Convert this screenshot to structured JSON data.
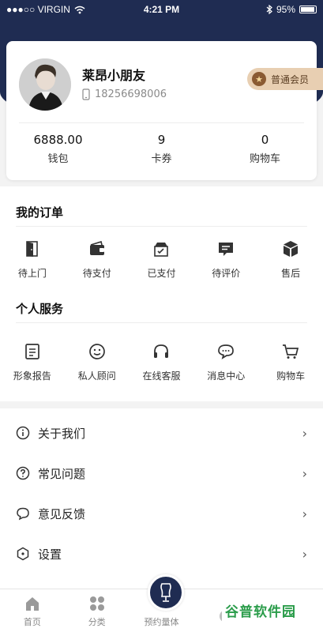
{
  "status_bar": {
    "carrier": "●●●○○ VIRGIN",
    "time": "4:21 PM",
    "battery": "95%"
  },
  "profile": {
    "name": "莱昂小朋友",
    "phone": "18256698006",
    "member_badge": "普通会员",
    "stats": [
      {
        "value": "6888.00",
        "label": "钱包"
      },
      {
        "value": "9",
        "label": "卡券"
      },
      {
        "value": "0",
        "label": "购物车"
      }
    ]
  },
  "orders": {
    "title": "我的订单",
    "items": [
      {
        "label": "待上门",
        "icon": "door-icon"
      },
      {
        "label": "待支付",
        "icon": "wallet-icon"
      },
      {
        "label": "已支付",
        "icon": "paid-box-icon"
      },
      {
        "label": "待评价",
        "icon": "comment-icon"
      },
      {
        "label": "售后",
        "icon": "package-icon"
      }
    ]
  },
  "services": {
    "title": "个人服务",
    "items": [
      {
        "label": "形象报告",
        "icon": "report-icon"
      },
      {
        "label": "私人顾问",
        "icon": "smiley-icon"
      },
      {
        "label": "在线客服",
        "icon": "headset-icon"
      },
      {
        "label": "消息中心",
        "icon": "chat-bubble-icon"
      },
      {
        "label": "购物车",
        "icon": "cart-icon"
      }
    ]
  },
  "menu": [
    {
      "label": "关于我们",
      "icon": "info-icon"
    },
    {
      "label": "常见问题",
      "icon": "question-icon"
    },
    {
      "label": "意见反馈",
      "icon": "feedback-icon"
    },
    {
      "label": "设置",
      "icon": "settings-icon"
    }
  ],
  "tab_bar": {
    "tabs": [
      {
        "label": "首页",
        "icon": "home-icon"
      },
      {
        "label": "分类",
        "icon": "grid-icon"
      },
      {
        "label": "预约量体",
        "icon": "mannequin-icon"
      },
      {
        "label": "",
        "icon": "circle-icon"
      },
      {
        "label": "",
        "icon": "profile-icon"
      }
    ]
  },
  "watermark": {
    "text": "谷普软件园"
  },
  "colors": {
    "header_navy": "#1f2c52",
    "badge_gold": "#e8cfb2",
    "watermark_green": "#2a9c4a"
  }
}
